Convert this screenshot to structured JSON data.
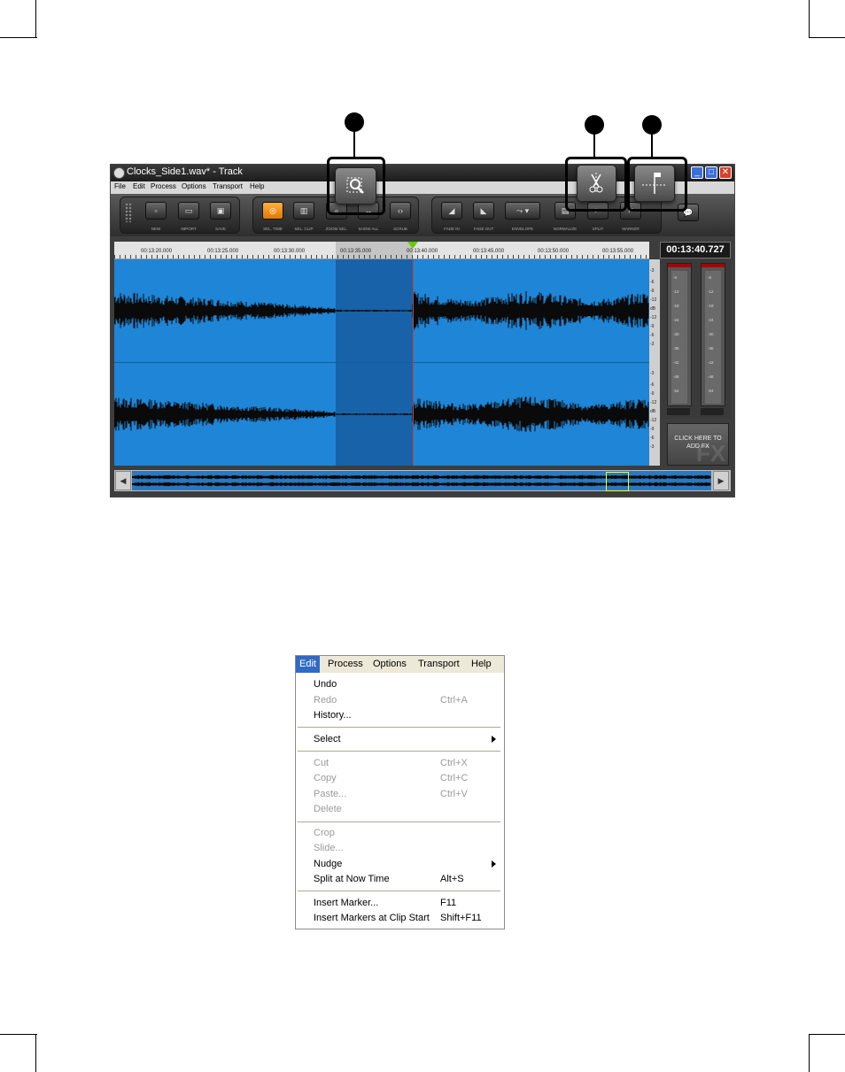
{
  "window": {
    "title": "Clocks_Side1.wav* - Track",
    "menu": [
      "File",
      "Edit",
      "Process",
      "Options",
      "Transport",
      "Help"
    ],
    "controls": [
      "minimize",
      "maximize",
      "close"
    ]
  },
  "toolbar": {
    "buttons": [
      {
        "label": "NEW",
        "icon": "new-file-icon"
      },
      {
        "label": "IMPORT",
        "icon": "folder-icon"
      },
      {
        "label": "SAVE",
        "icon": "floppy-icon"
      },
      {
        "label": "SEL. TIME",
        "icon": "select-time-icon",
        "active": true
      },
      {
        "label": "SEL. CLIP",
        "icon": "select-clip-icon"
      },
      {
        "label": "ZOOM SEL.",
        "icon": "zoom-selection-icon"
      },
      {
        "label": "SHOW ALL",
        "icon": "show-all-icon"
      },
      {
        "label": "SCRUB",
        "icon": "scrub-icon"
      },
      {
        "label": "FADE IN",
        "icon": "fade-in-icon"
      },
      {
        "label": "FADE OUT",
        "icon": "fade-out-icon"
      },
      {
        "label": "ENVELOPE",
        "icon": "envelope-icon"
      },
      {
        "label": "NORMALIZE",
        "icon": "normalize-icon"
      },
      {
        "label": "SPLIT",
        "icon": "split-icon"
      },
      {
        "label": "MARKER",
        "icon": "marker-icon"
      }
    ]
  },
  "ruler": {
    "labels": [
      "00:13:20.000",
      "00:13:25.000",
      "00:13:30.000",
      "00:13:35.000",
      "00:13:40.000",
      "00:13:45.000",
      "00:13:50.000",
      "00:13:55.000"
    ]
  },
  "time_display": "00:13:40.727",
  "db_scale": [
    "-3",
    "-6",
    "-9",
    "-12",
    "dB",
    "-12",
    "-9",
    "-6",
    "-3"
  ],
  "meter_scale": [
    "-6",
    "-12",
    "-18",
    "-24",
    "-30",
    "-36",
    "-42",
    "-48",
    "-54"
  ],
  "fx_box": {
    "line1": "CLICK HERE TO",
    "line2": "ADD FX",
    "watermark": "FX"
  },
  "callouts": [
    "zoom-selection",
    "split",
    "marker"
  ],
  "edit_menu": {
    "menubar": [
      "Edit",
      "Process",
      "Options",
      "Transport",
      "Help"
    ],
    "items": [
      {
        "label": "Undo",
        "shortcut": "",
        "disabled": false
      },
      {
        "label": "Redo",
        "shortcut": "Ctrl+A",
        "disabled": true
      },
      {
        "label": "History...",
        "shortcut": "",
        "disabled": false
      },
      {
        "label": "Select",
        "shortcut": "",
        "disabled": false,
        "submenu": true
      },
      {
        "label": "Cut",
        "shortcut": "Ctrl+X",
        "disabled": true
      },
      {
        "label": "Copy",
        "shortcut": "Ctrl+C",
        "disabled": true
      },
      {
        "label": "Paste...",
        "shortcut": "Ctrl+V",
        "disabled": true
      },
      {
        "label": "Delete",
        "shortcut": "",
        "disabled": true
      },
      {
        "label": "Crop",
        "shortcut": "",
        "disabled": true
      },
      {
        "label": "Slide...",
        "shortcut": "",
        "disabled": true
      },
      {
        "label": "Nudge",
        "shortcut": "",
        "disabled": false,
        "submenu": true
      },
      {
        "label": "Split at Now Time",
        "shortcut": "Alt+S",
        "disabled": false
      },
      {
        "label": "Insert Marker...",
        "shortcut": "F11",
        "disabled": false
      },
      {
        "label": "Insert Markers at Clip Start",
        "shortcut": "Shift+F11",
        "disabled": false
      }
    ]
  }
}
